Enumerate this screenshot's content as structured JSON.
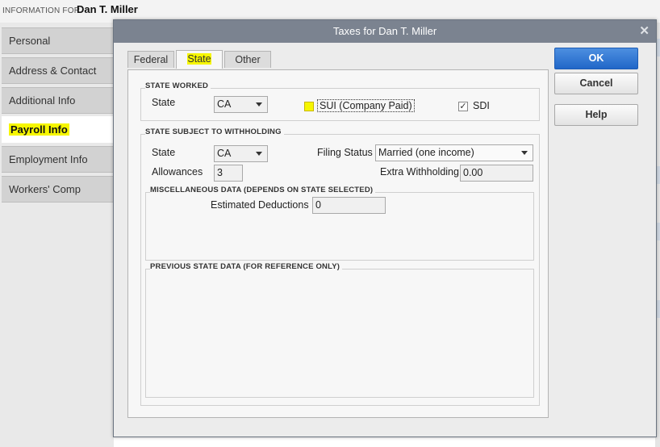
{
  "header": {
    "info_label": "INFORMATION FOR",
    "employee_name": "Dan T. Miller"
  },
  "sidebar": {
    "items": [
      {
        "label": "Personal"
      },
      {
        "label": "Address & Contact"
      },
      {
        "label": "Additional Info"
      },
      {
        "label": "Payroll Info",
        "active": true
      },
      {
        "label": "Employment Info"
      },
      {
        "label": "Workers' Comp"
      }
    ]
  },
  "dialog": {
    "title": "Taxes for Dan T. Miller",
    "tabs": [
      {
        "label": "Federal"
      },
      {
        "label": "State",
        "active": true
      },
      {
        "label": "Other"
      }
    ],
    "state_worked": {
      "heading": "STATE WORKED",
      "state_label": "State",
      "state_value": "CA",
      "sui_label": "SUI (Company Paid)",
      "sui_checked": false,
      "sdi_label": "SDI",
      "sdi_checked": true
    },
    "withholding": {
      "heading": "STATE SUBJECT TO WITHHOLDING",
      "state_label": "State",
      "state_value": "CA",
      "filing_status_label": "Filing Status",
      "filing_status_value": "Married (one income)",
      "allowances_label": "Allowances",
      "allowances_value": "3",
      "extra_withholding_label": "Extra Withholding",
      "extra_withholding_value": "0.00"
    },
    "misc": {
      "heading": "MISCELLANEOUS DATA (DEPENDS ON STATE SELECTED)",
      "estimated_deductions_label": "Estimated Deductions",
      "estimated_deductions_value": "0"
    },
    "previous": {
      "heading": "PREVIOUS STATE DATA (FOR REFERENCE ONLY)"
    },
    "buttons": {
      "ok": "OK",
      "cancel": "Cancel",
      "help": "Help"
    }
  },
  "icons": {
    "close": "close-icon",
    "checkmark": "checkmark-icon",
    "dropdown": "chevron-down-icon"
  },
  "colors": {
    "highlight": "#f6f600",
    "ok_button": "#2f78d6",
    "titlebar": "#7b8390"
  }
}
